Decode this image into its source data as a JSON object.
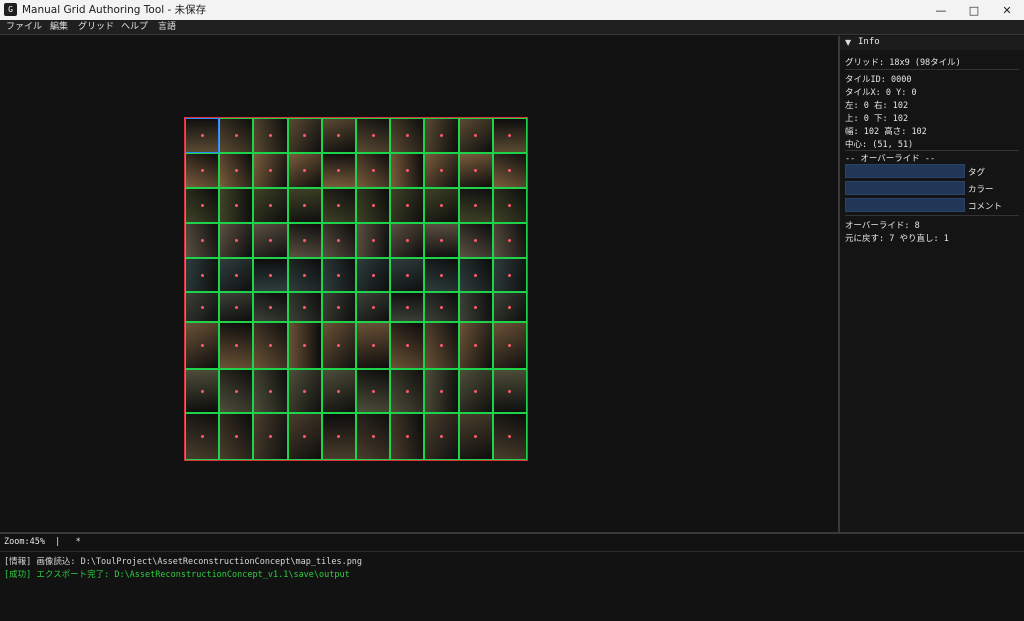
{
  "window": {
    "title": "Manual Grid Authoring Tool - 未保存",
    "icon": "app-icon",
    "controls": [
      "minimize-icon",
      "maximize-icon",
      "close-icon"
    ]
  },
  "menu": [
    "ファイル",
    "編集",
    "グリッド",
    "ヘルプ",
    "言語"
  ],
  "grid": {
    "columns": 10,
    "rows": 9,
    "selected_tile": 0,
    "border_color": "#e0303a",
    "cell_color": "#1ed34a",
    "selected_color": "#2f8cff",
    "row_tones": [
      "#5a4a32",
      "#7a5c3c",
      "#3f4226",
      "#5b5042",
      "#2e3d3c",
      "#3c4136",
      "#6b5236",
      "#4e4e3a",
      "#4a3d2c"
    ]
  },
  "info": {
    "header": "Info",
    "grid_line": "グリッド: 18x9 (98タイル)",
    "tile_id": "タイルID: 0000",
    "tile_xy": "タイルX: 0  Y: 0",
    "left_right": "左: 0  右: 102",
    "top_bottom": "上: 0  下: 102",
    "size": "幅: 102  高さ: 102",
    "center": "中心: (51, 51)",
    "override_header": "-- オーバーライド --",
    "fields": [
      {
        "label": "タグ",
        "value": ""
      },
      {
        "label": "カラー",
        "value": ""
      },
      {
        "label": "コメント",
        "value": ""
      }
    ],
    "override_count": "オーバーライド: 8",
    "undo_redo": "元に戻す: 7  やり直し: 1"
  },
  "status": {
    "zoom": "Zoom:45%  |   *"
  },
  "log": [
    {
      "kind": "info",
      "text": "[情報] 画像読込: D:\\ToulProject\\AssetReconstructionConcept\\map_tiles.png"
    },
    {
      "kind": "ok",
      "text": "[成功] エクスポート完了: D:\\AssetReconstructionConcept_v1.1\\save\\output"
    }
  ]
}
